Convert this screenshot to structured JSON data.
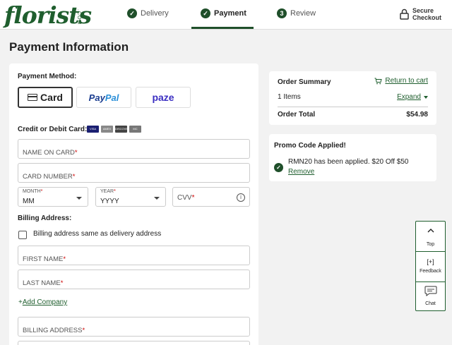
{
  "header": {
    "logo": "florists",
    "logo_suffix": ".COM",
    "steps": [
      {
        "label": "Delivery",
        "marker": "✓"
      },
      {
        "label": "Payment",
        "marker": "✓"
      },
      {
        "label": "Review",
        "marker": "3"
      }
    ],
    "secure_line1": "Secure",
    "secure_line2": "Checkout"
  },
  "page_title": "Payment Information",
  "payment": {
    "method_label": "Payment Method:",
    "methods": [
      "Card",
      "PayPal",
      "paze"
    ],
    "credit_label": "Credit or Debit Card:",
    "card_logos": [
      "VISA",
      "AMEX",
      "DISCOVER",
      "MC"
    ],
    "name_placeholder": "NAME ON CARD",
    "number_placeholder": "CARD NUMBER",
    "month_label": "MONTH",
    "month_value": "MM",
    "year_label": "YEAR",
    "year_value": "YYYY",
    "cvv_placeholder": "CVV",
    "info_glyph": "i",
    "required_mark": "*"
  },
  "billing": {
    "label": "Billing Address:",
    "same_as_delivery": "Billing address same as delivery address",
    "first_name": "FIRST NAME",
    "last_name": "LAST NAME",
    "add_company_plus": "+",
    "add_company": "Add Company",
    "billing_address": "BILLING ADDRESS"
  },
  "order_summary": {
    "title": "Order Summary",
    "return_to_cart": "Return to cart",
    "items": "1 Items",
    "expand": "Expand",
    "total_label": "Order Total",
    "total_value": "$54.98"
  },
  "promo": {
    "title": "Promo Code Applied!",
    "message": "RMN20 has been applied. $20 Off $50",
    "remove": "Remove",
    "check_glyph": "✓"
  },
  "float_bar": {
    "top": "Top",
    "feedback": "Feedback",
    "feedback_glyph": "[+]",
    "chat": "Chat"
  },
  "colors": {
    "brand_green": "#1f5e2e",
    "dark_green": "#1f4f2a",
    "paze_purple": "#3b2fc2",
    "required_red": "#cc0000"
  }
}
